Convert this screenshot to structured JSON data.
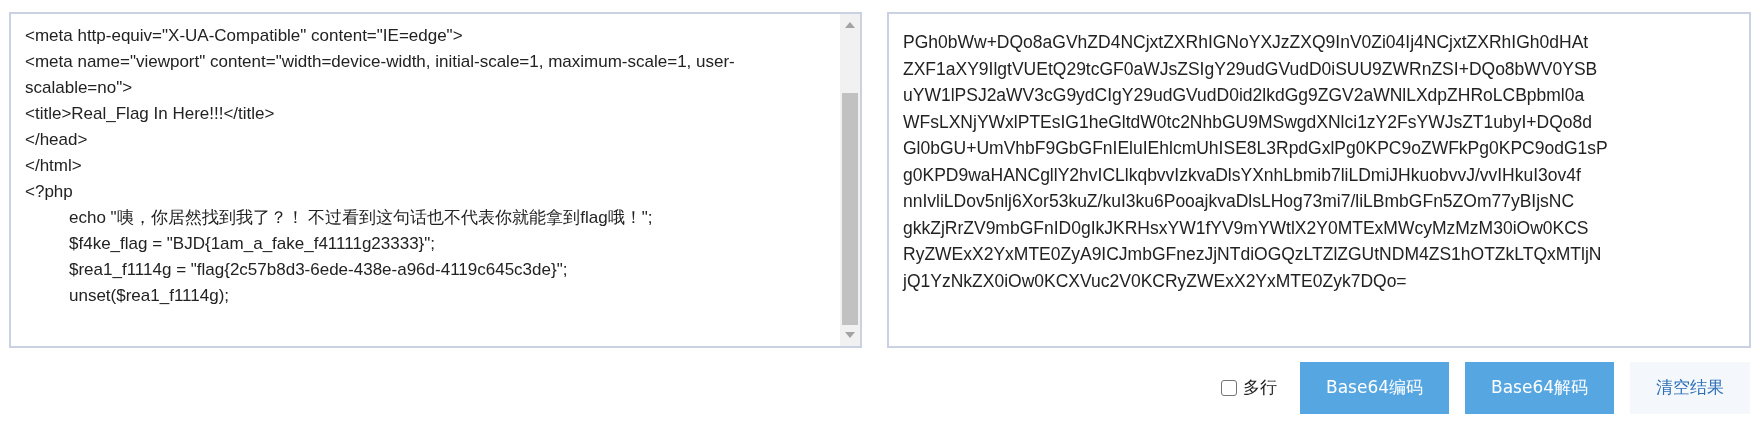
{
  "source_editor": {
    "lines": [
      {
        "kind": "plain",
        "text": "<meta http-equiv=\"X-UA-Compatible\" content=\"IE=edge\">"
      },
      {
        "kind": "plain",
        "text": "<meta name=\"viewport\" content=\"width=device-width, initial-scale=1, maximum-scale=1, user-scalable=no\">"
      },
      {
        "kind": "plain",
        "text": "<title>Real_Flag In Here!!!</title>"
      },
      {
        "kind": "plain",
        "text": "</head>"
      },
      {
        "kind": "plain",
        "text": "</html>"
      },
      {
        "kind": "plain",
        "text": "<?php"
      },
      {
        "kind": "indented",
        "text": "echo \"咦，你居然找到我了？！ 不过看到这句话也不代表你就能拿到flag哦！\";"
      },
      {
        "kind": "indented",
        "text": "$f4ke_flag = \"BJD{1am_a_fake_f41111g23333}\";"
      },
      {
        "kind": "indented",
        "text": "$rea1_f1114g = \"flag{2c57b8d3-6ede-438e-a96d-4119c645c3de}\";"
      },
      {
        "kind": "indented",
        "text": "unset($rea1_f1114g);"
      }
    ]
  },
  "result_editor": {
    "lines": [
      "PGh0bWw+DQo8aGVhZD4NCjxtZXRhIGNoYXJzZXQ9InV0Zi04Ij4NCjxtZXRhIGh0dHAt",
      "ZXF1aXY9IlgtVUEtQ29tcGF0aWJsZSIgY29udGVudD0iSUU9ZWRnZSI+DQo8bWV0YSB",
      "uYW1lPSJ2aWV3cG9ydCIgY29udGVudD0id2lkdGg9ZGV2aWNlLXdpZHRoLCBpbml0a",
      "WFsLXNjYWxlPTEsIG1heGltdW0tc2NhbGU9MSwgdXNlci1zY2FsYWJsZT1ubyI+DQo8d",
      "Gl0bGU+UmVhbF9GbGFnIEluIEhlcmUhISE8L3RpdGxlPg0KPC9oZWFkPg0KPC9odG1sP",
      "g0KPD9waHANCgllY2hvICLlkqbvvIzkvaDlsYXnhLbmib7liLDmiJHkuobvvJ/vvIHkuI3ov4f",
      "nnIvliLDov5nlj6Xor53kuZ/kuI3ku6PooajkvaDlsLHog73mi7/liLBmbGFn5ZOm77yBIjsNC",
      "gkkZjRrZV9mbGFnID0gIkJKRHsxYW1fYV9mYWtlX2Y0MTExMWcyMzMzM30iOw0KCS",
      "RyZWExX2YxMTE0ZyA9ICJmbGFnezJjNTdiOGQzLTZlZGUtNDM4ZS1hOTZkLTQxMTljN",
      "jQ1YzNkZX0iOw0KCXVuc2V0KCRyZWExX2YxMTE0Zyk7DQo="
    ]
  },
  "toolbar": {
    "multiline": {
      "label": "多行",
      "checked": false
    },
    "buttons": [
      {
        "kind": "primary",
        "label": "Base64编码"
      },
      {
        "kind": "primary",
        "label": "Base64解码"
      },
      {
        "kind": "light",
        "label": "清空结果"
      }
    ]
  }
}
